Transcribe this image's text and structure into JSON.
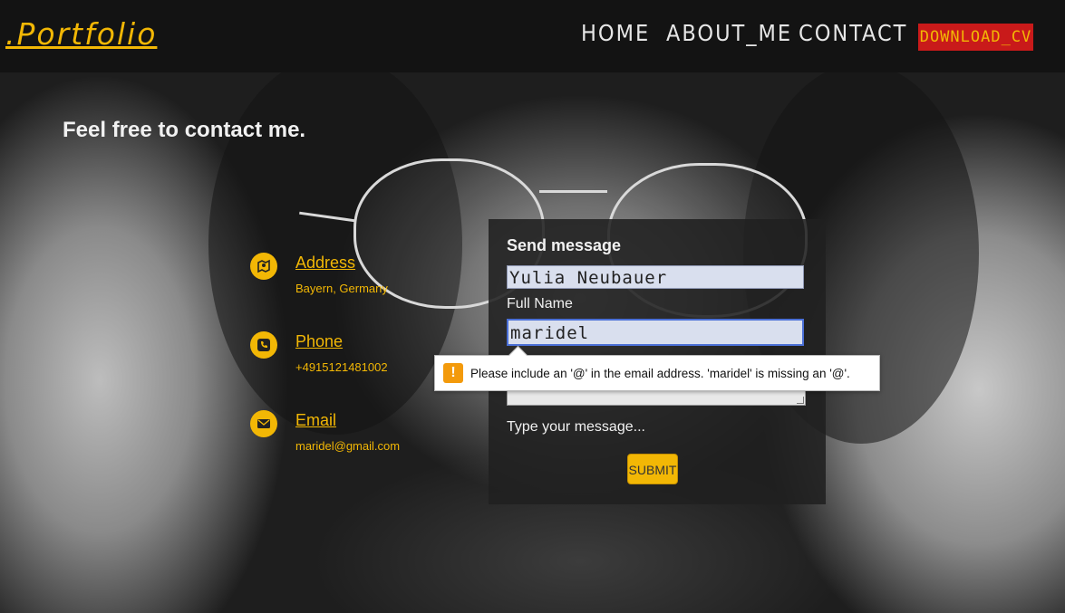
{
  "header": {
    "logo": ".Portfolio",
    "nav": {
      "home": "HOME",
      "about": "ABOUT_ME",
      "contact": "CONTACT"
    },
    "download_cv": "DOWNLOAD_CV"
  },
  "page": {
    "heading": "Feel free to contact me."
  },
  "contact_info": {
    "address": {
      "title": "Address",
      "value": "Bayern, Germany",
      "icon": "map-icon"
    },
    "phone": {
      "title": "Phone",
      "value": "+4915121481002",
      "icon": "phone-icon"
    },
    "email": {
      "title": "Email",
      "value": "maridel@gmail.com",
      "icon": "envelope-icon"
    }
  },
  "form": {
    "title": "Send message",
    "name_value": "Yulia Neubauer",
    "name_label": "Full Name",
    "email_value": "maridel",
    "message_placeholder": "Type your message...",
    "submit_label": "SUBMIT"
  },
  "validation": {
    "message": "Please include an '@' in the email address. 'maridel' is missing an '@'.",
    "icon": "warning-icon"
  },
  "colors": {
    "accent": "#f2b705",
    "cv_button": "#c91a1a",
    "header_bg": "#121212"
  }
}
